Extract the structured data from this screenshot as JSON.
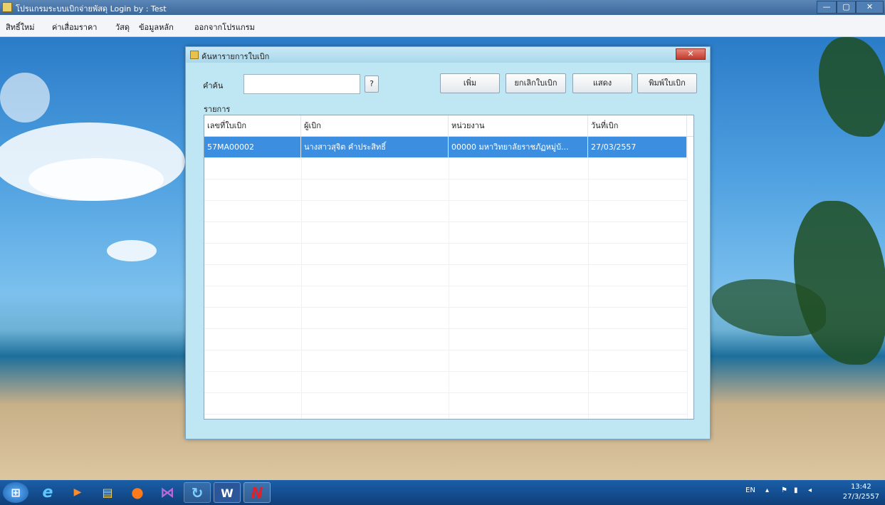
{
  "window": {
    "title": "โปรแกรมระบบเบิกจ่ายพัสดุ  Login by : Test",
    "min": "—",
    "max": "▢",
    "close": "✕"
  },
  "menu": [
    "สิทธิ์ใหม่",
    "ค่าเสื่อมราคา",
    "วัสดุ",
    "ข้อมูลหลัก",
    "ออกจากโปรแกรม"
  ],
  "dialog": {
    "title": "ค้นหารายการใบเบิก",
    "close": "✕",
    "search_label": "คำค้น",
    "search_value": "",
    "help_button": "?",
    "buttons": {
      "add": "เพิ่ม",
      "cancel": "ยกเลิกใบเบิก",
      "show": "แสดง",
      "print": "พิมพ์ใบเบิก"
    },
    "list_label": "รายการ",
    "columns": [
      "เลขที่ใบเบิก",
      "ผู้เบิก",
      "หน่วยงาน",
      "วันที่เบิก"
    ],
    "rows": [
      [
        "57MA00002",
        "นางสาวสุจิต คำประสิทธิ์",
        "00000 มหาวิทยาลัยราชภัฏหมู่บ้...",
        "27/03/2557"
      ]
    ]
  },
  "taskbar": {
    "apps": [
      {
        "name": "start-orb",
        "glyph": "⊞"
      },
      {
        "name": "internet-explorer",
        "glyph": "e"
      },
      {
        "name": "media-player",
        "glyph": "▶"
      },
      {
        "name": "file-explorer",
        "glyph": "▤"
      },
      {
        "name": "firefox",
        "glyph": "●"
      },
      {
        "name": "visual-studio",
        "glyph": "⋈"
      },
      {
        "name": "refresh-app",
        "glyph": "↻"
      },
      {
        "name": "word",
        "glyph": "W"
      },
      {
        "name": "n-app",
        "glyph": "N"
      }
    ],
    "lang": "EN",
    "time": "13:42",
    "date": "27/3/2557"
  },
  "colors": {
    "selection": "#3c8fe0",
    "dialog_bg": "#bfe6f3",
    "taskbar": "#144f93"
  }
}
